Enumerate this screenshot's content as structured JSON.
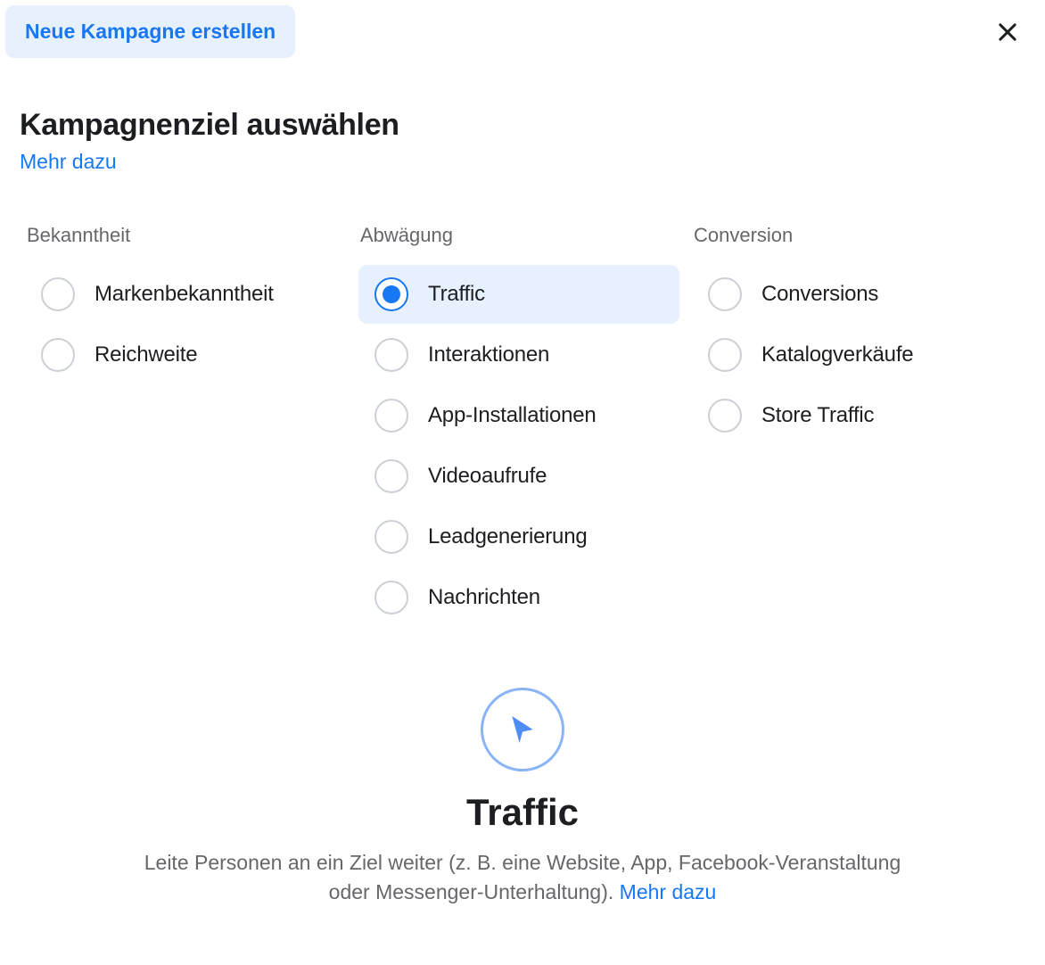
{
  "header": {
    "pill_label": "Neue Kampagne erstellen"
  },
  "title_block": {
    "title": "Kampagnenziel auswählen",
    "learn_more": "Mehr dazu"
  },
  "columns": [
    {
      "header": "Bekanntheit",
      "options": [
        {
          "label": "Markenbekanntheit",
          "selected": false
        },
        {
          "label": "Reichweite",
          "selected": false
        }
      ]
    },
    {
      "header": "Abwägung",
      "options": [
        {
          "label": "Traffic",
          "selected": true
        },
        {
          "label": "Interaktionen",
          "selected": false
        },
        {
          "label": "App-Installationen",
          "selected": false
        },
        {
          "label": "Videoaufrufe",
          "selected": false
        },
        {
          "label": "Leadgenerierung",
          "selected": false
        },
        {
          "label": "Nachrichten",
          "selected": false
        }
      ]
    },
    {
      "header": "Conversion",
      "options": [
        {
          "label": "Conversions",
          "selected": false
        },
        {
          "label": "Katalogverkäufe",
          "selected": false
        },
        {
          "label": "Store Traffic",
          "selected": false
        }
      ]
    }
  ],
  "detail": {
    "title": "Traffic",
    "description": "Leite Personen an ein Ziel weiter (z. B. eine Website, App, Facebook-Veranstaltung oder Messenger-Unterhaltung). ",
    "learn_more": "Mehr dazu"
  },
  "colors": {
    "accent": "#1877f2",
    "pill_bg": "#e7f0fd",
    "selected_bg": "#e6f0ff",
    "muted": "#65676b"
  }
}
